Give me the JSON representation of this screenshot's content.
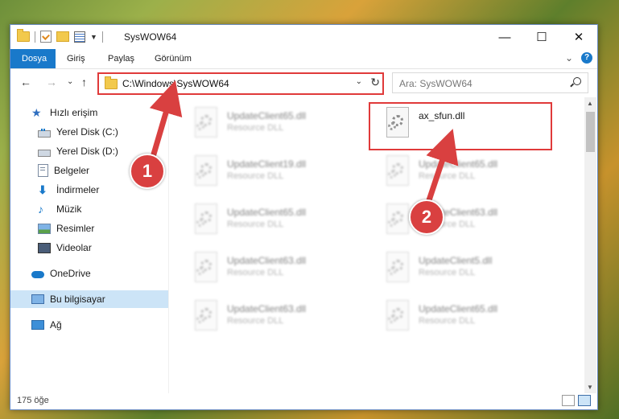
{
  "window": {
    "title": "SysWOW64",
    "minimize": "—",
    "maximize": "☐",
    "close": "✕"
  },
  "ribbon": {
    "tabs": [
      {
        "label": "Dosya"
      },
      {
        "label": "Giriş"
      },
      {
        "label": "Paylaş"
      },
      {
        "label": "Görünüm"
      }
    ],
    "help": "?",
    "expand": "⌄"
  },
  "nav": {
    "back": "←",
    "forward": "→",
    "recent": "⌄",
    "up": "↑",
    "address": "C:\\Windows\\SysWOW64",
    "address_dropdown": "⌄",
    "refresh": "↻",
    "search_placeholder": "Ara: SysWOW64"
  },
  "sidebar": {
    "items": [
      {
        "label": "Hızlı erişim",
        "icon": "star-icon"
      },
      {
        "label": "Yerel Disk (C:)",
        "icon": "drive-icon",
        "pin": "📌"
      },
      {
        "label": "Yerel Disk (D:)",
        "icon": "drive-icon",
        "pin": "📌"
      },
      {
        "label": "Belgeler",
        "icon": "document-icon",
        "pin": "📌"
      },
      {
        "label": "İndirmeler",
        "icon": "download-icon",
        "pin": "📌"
      },
      {
        "label": "Müzik",
        "icon": "music-icon",
        "pin": "📌"
      },
      {
        "label": "Resimler",
        "icon": "pictures-icon",
        "pin": "📌"
      },
      {
        "label": "Videolar",
        "icon": "videos-icon",
        "pin": "📌"
      },
      {
        "label": "OneDrive",
        "icon": "cloud-icon"
      },
      {
        "label": "Bu bilgisayar",
        "icon": "computer-icon"
      },
      {
        "label": "Ağ",
        "icon": "network-icon"
      }
    ]
  },
  "files": {
    "left": [
      {
        "name": "UpdateClient65.dll",
        "desc": "Resource DLL"
      },
      {
        "name": "UpdateClient19.dll",
        "desc": "Resource DLL"
      },
      {
        "name": "UpdateClient65.dll",
        "desc": "Resource DLL"
      },
      {
        "name": "UpdateClient63.dll",
        "desc": "Resource DLL"
      },
      {
        "name": "UpdateClient63.dll",
        "desc": "Resource DLL"
      }
    ],
    "right": [
      {
        "name": "ax_sfun.dll",
        "desc": ""
      },
      {
        "name": "UpdateClient65.dll",
        "desc": "Resource DLL"
      },
      {
        "name": "UpdateClient63.dll",
        "desc": "Resource DLL"
      },
      {
        "name": "UpdateClient5.dll",
        "desc": "Resource DLL"
      },
      {
        "name": "UpdateClient65.dll",
        "desc": "Resource DLL"
      }
    ]
  },
  "status": {
    "count": "175 öğe"
  },
  "callouts": {
    "one": "1",
    "two": "2"
  },
  "colors": {
    "accent": "#1979ca",
    "highlight": "#e03a3a"
  }
}
